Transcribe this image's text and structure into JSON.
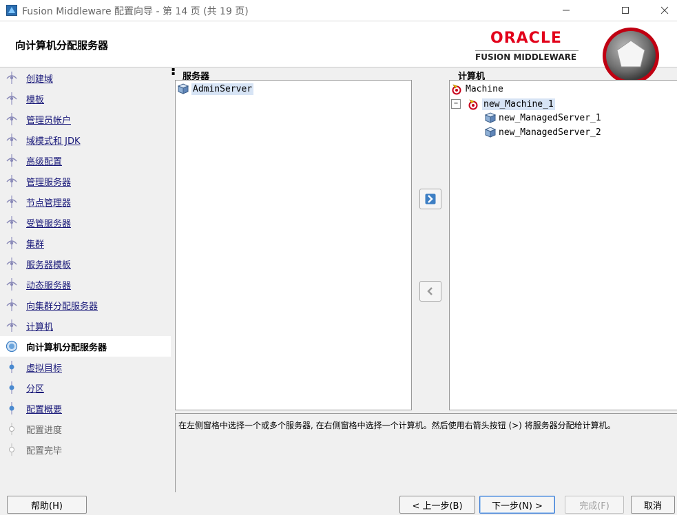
{
  "window": {
    "title": "Fusion Middleware 配置向导 - 第 14 页 (共 19 页)",
    "controls": {
      "minimize": "—",
      "maximize": "☐",
      "close": "✕"
    }
  },
  "header": {
    "page_title": "向计算机分配服务器",
    "brand_oracle": "ORACLE",
    "brand_fusion": "FUSION MIDDLEWARE"
  },
  "sidebar": {
    "items": [
      {
        "label": "创建域",
        "state": "done"
      },
      {
        "label": "模板",
        "state": "done"
      },
      {
        "label": "管理员帐户",
        "state": "done"
      },
      {
        "label": "域模式和 JDK",
        "state": "done"
      },
      {
        "label": "高级配置",
        "state": "done"
      },
      {
        "label": "管理服务器",
        "state": "done"
      },
      {
        "label": "节点管理器",
        "state": "done"
      },
      {
        "label": "受管服务器",
        "state": "done"
      },
      {
        "label": "集群",
        "state": "done"
      },
      {
        "label": "服务器模板",
        "state": "done"
      },
      {
        "label": "动态服务器",
        "state": "done"
      },
      {
        "label": "向集群分配服务器",
        "state": "done"
      },
      {
        "label": "计算机",
        "state": "done"
      },
      {
        "label": "向计算机分配服务器",
        "state": "active"
      },
      {
        "label": "虚拟目标",
        "state": "pending"
      },
      {
        "label": "分区",
        "state": "pending"
      },
      {
        "label": "配置概要",
        "state": "pending"
      },
      {
        "label": "配置进度",
        "state": "disabled"
      },
      {
        "label": "配置完毕",
        "state": "disabled"
      }
    ]
  },
  "servers_panel": {
    "heading": "服务器",
    "items": [
      {
        "label": "AdminServer",
        "icon": "server-icon"
      }
    ]
  },
  "machines_panel": {
    "heading": "计算机",
    "root": {
      "label": "Machine",
      "icon": "machine-icon"
    },
    "machine": {
      "label": "new_Machine_1",
      "expand": "−"
    },
    "servers": [
      {
        "label": "new_ManagedServer_1"
      },
      {
        "label": "new_ManagedServer_2"
      }
    ]
  },
  "description": "在左侧窗格中选择一个或多个服务器, 在右侧窗格中选择一个计算机。然后使用右箭头按钮 (>) 将服务器分配给计算机。",
  "buttons": {
    "help": "帮助(H)",
    "back": "< 上一步(B)",
    "next": "下一步(N) >",
    "finish": "完成(F)",
    "cancel": "取消"
  },
  "colors": {
    "oracle_red": "#e2001a",
    "nav_link": "#1a1a7a",
    "selection": "#d7e4f5"
  }
}
